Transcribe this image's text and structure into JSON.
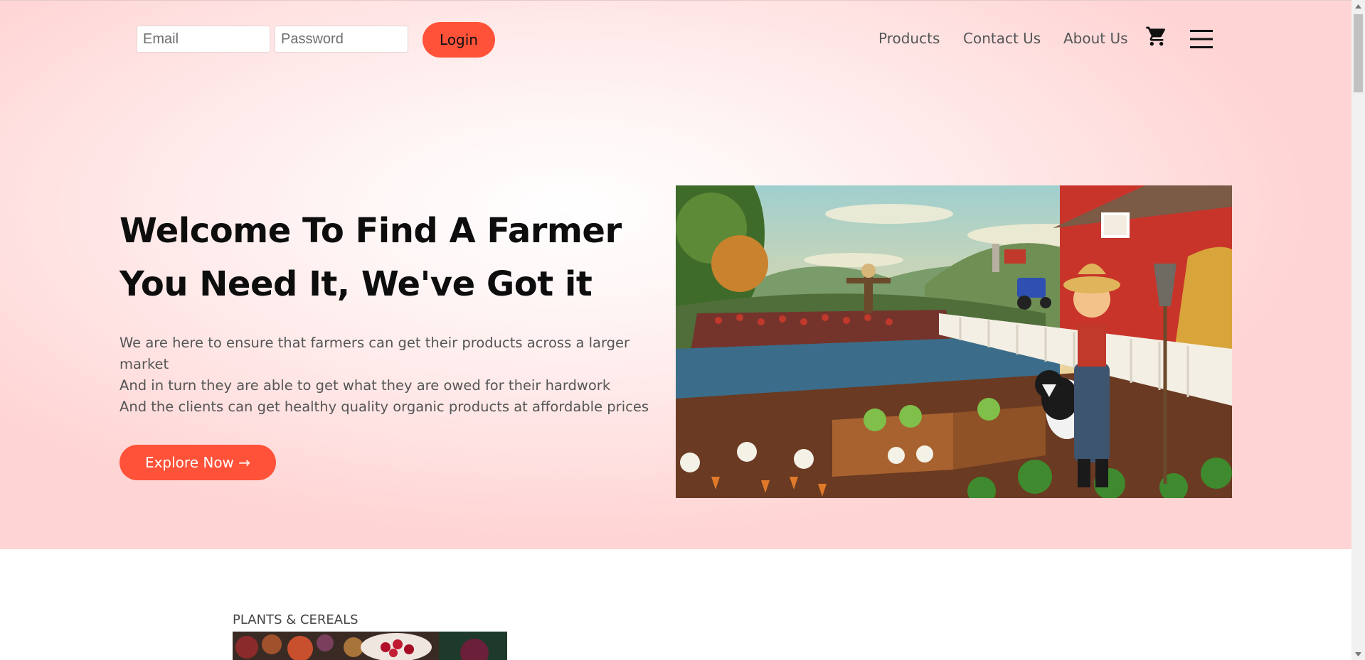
{
  "header": {
    "email_placeholder": "Email",
    "password_placeholder": "Password",
    "login_label": "Login",
    "nav": {
      "products": "Products",
      "contact": "Contact Us",
      "about": "About Us"
    },
    "icons": [
      "cart-icon",
      "hamburger-menu-icon"
    ]
  },
  "hero": {
    "title_line1": "Welcome To Find A Farmer",
    "title_line2": "You Need It, We've Got it",
    "desc_line1": "We are here to ensure that farmers can get their products across a larger market",
    "desc_line2": "And in turn they are able to get what they are owed for their hardwork",
    "desc_line3": "And the clients can get healthy quality organic products at affordable prices",
    "explore_label": "Explore Now →"
  },
  "categories": {
    "first_label": "PLANTS & CEREALS"
  },
  "colors": {
    "accent": "#ff5238",
    "hero_bg": "#ffdede",
    "title": "#0d0d0d",
    "text": "#555555"
  }
}
